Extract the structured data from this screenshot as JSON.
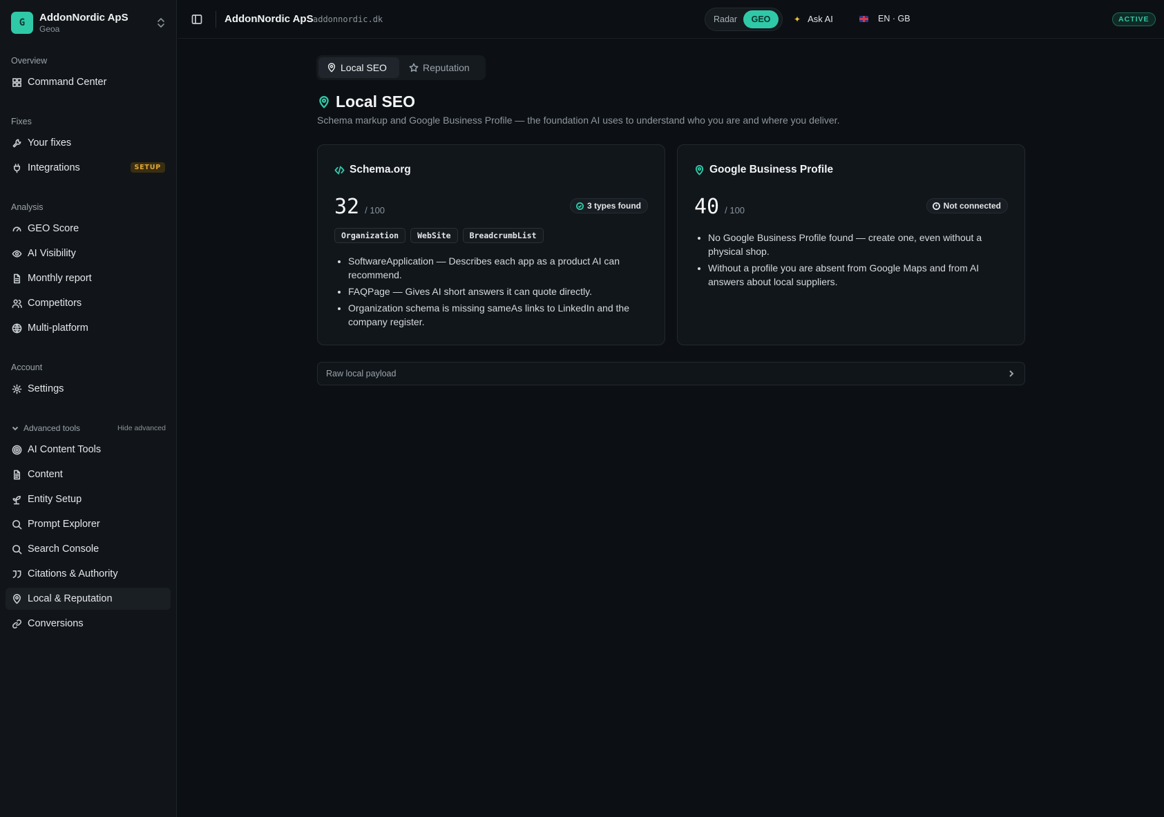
{
  "workspace": {
    "avatar_letter": "G",
    "name": "AddonNordic ApS",
    "sub": "Geoa"
  },
  "sidebar": {
    "groups": [
      {
        "label": "Overview"
      },
      {
        "label": "Fixes"
      },
      {
        "label": "Analysis"
      },
      {
        "label": "Account"
      }
    ],
    "items": [
      {
        "label": "Command Center",
        "icon": "grid-icon"
      },
      {
        "label": "Your fixes",
        "icon": "wrench-icon"
      },
      {
        "label": "Integrations",
        "icon": "plug-icon",
        "badge": "SETUP"
      },
      {
        "label": "GEO Score",
        "icon": "gauge-icon"
      },
      {
        "label": "AI Visibility",
        "icon": "eye-icon"
      },
      {
        "label": "Monthly report",
        "icon": "file-icon"
      },
      {
        "label": "Competitors",
        "icon": "users-icon"
      },
      {
        "label": "Multi-platform",
        "icon": "globe-icon"
      },
      {
        "label": "Settings",
        "icon": "gear-icon"
      }
    ],
    "advanced": {
      "label": "Advanced tools",
      "hide": "Hide advanced",
      "items": [
        {
          "label": "AI Content Tools",
          "icon": "target-icon"
        },
        {
          "label": "Content",
          "icon": "document-icon"
        },
        {
          "label": "Entity Setup",
          "icon": "sprout-icon"
        },
        {
          "label": "Prompt Explorer",
          "icon": "search-icon"
        },
        {
          "label": "Search Console",
          "icon": "search-icon"
        },
        {
          "label": "Citations & Authority",
          "icon": "quote-icon"
        },
        {
          "label": "Local & Reputation",
          "icon": "map-pin-icon",
          "active": true
        },
        {
          "label": "Conversions",
          "icon": "link-icon"
        }
      ]
    }
  },
  "header": {
    "title": "AddonNordic ApS",
    "domain": "addonnordic.dk",
    "mode": {
      "options": [
        "Radar",
        "GEO"
      ],
      "selected": "GEO"
    },
    "ask_ai": "Ask AI",
    "language": "EN · GB",
    "status": "ACTIVE"
  },
  "tabs": {
    "local": "Local SEO",
    "reputation": "Reputation",
    "selected": "Local SEO"
  },
  "page": {
    "title": "Local SEO",
    "subtitle": "Schema markup and Google Business Profile — the foundation AI uses to understand who you are and where you deliver."
  },
  "schema_card": {
    "title": "Schema.org",
    "score": "32",
    "score_max": "/ 100",
    "status": "3 types found",
    "types": [
      "Organization",
      "WebSite",
      "BreadcrumbList"
    ],
    "bullets": [
      "SoftwareApplication — Describes each app as a product AI can recommend.",
      "FAQPage — Gives AI short answers it can quote directly.",
      "Organization schema is missing sameAs links to LinkedIn and the company register."
    ]
  },
  "gbp_card": {
    "title": "Google Business Profile",
    "score": "40",
    "score_max": "/ 100",
    "status": "Not connected",
    "bullets": [
      "No Google Business Profile found — create one, even without a physical shop.",
      "Without a profile you are absent from Google Maps and from AI answers about local suppliers."
    ]
  },
  "raw_payload": {
    "label": "Raw local payload"
  },
  "colors": {
    "accent": "#2fc9a8",
    "background": "#0c1014",
    "sidebar": "#111519",
    "warning": "#e0a83a"
  }
}
